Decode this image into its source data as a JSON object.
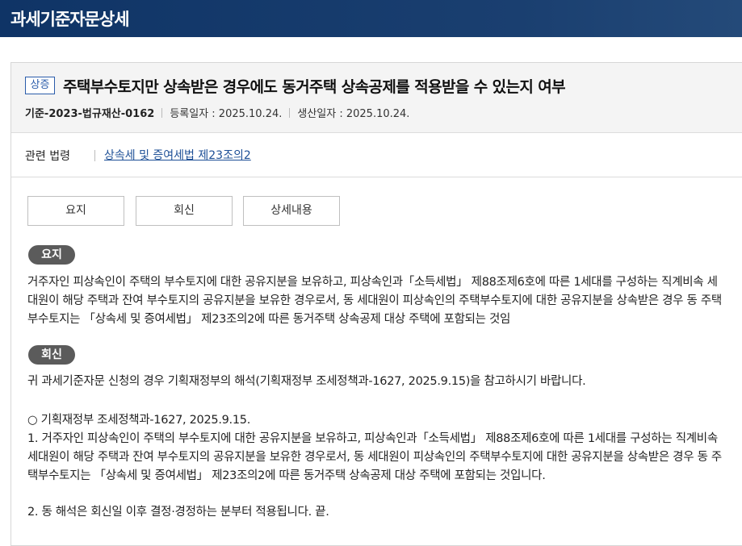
{
  "header": {
    "title": "과세기준자문상세"
  },
  "doc": {
    "badge": "상증",
    "title": "주택부수토지만 상속받은 경우에도 동거주택 상속공제를 적용받을 수 있는지 여부",
    "code": "기준-2023-법규재산-0162",
    "registered": "등록일자 : 2025.10.24.",
    "produced": "생산일자 : 2025.10.24."
  },
  "related_law": {
    "label": "관련 법령",
    "link": "상속세 및 증여세법 제23조의2"
  },
  "tabs": [
    "요지",
    "회신",
    "상세내용"
  ],
  "summary": {
    "label": "요지",
    "text": "거주자인 피상속인이 주택의 부수토지에 대한 공유지분을 보유하고, 피상속인과「소득세법」 제88조제6호에 따른 1세대를 구성하는 직계비속 세대원이 해당 주택과 잔여 부수토지의 공유지분을 보유한 경우로서, 동 세대원이 피상속인의 주택부수토지에 대한 공유지분을 상속받은 경우 동 주택부수토지는 「상속세 및 증여세법」 제23조의2에 따른 동거주택 상속공제 대상 주택에 포함되는 것임"
  },
  "reply": {
    "label": "회신",
    "intro": "귀 과세기준자문 신청의 경우 기획재정부의 해석(기획재정부 조세정책과-1627, 2025.9.15)을 참고하시기 바랍니다.",
    "ref": "○ 기획재정부 조세정책과-1627, 2025.9.15.",
    "item1": "1. 거주자인 피상속인이 주택의 부수토지에 대한 공유지분을 보유하고, 피상속인과「소득세법」 제88조제6호에 따른 1세대를 구성하는 직계비속 세대원이 해당 주택과 잔여 부수토지의 공유지분을 보유한 경우로서, 동 세대원이 피상속인의 주택부수토지에 대한 공유지분을 상속받은 경우 동 주택부수토지는 「상속세 및 증여세법」 제23조의2에 따른 동거주택 상속공제 대상 주택에 포함되는 것입니다.",
    "item2": "2. 동 해석은 회신일 이후 결정·경정하는 분부터 적용됩니다. 끝."
  }
}
